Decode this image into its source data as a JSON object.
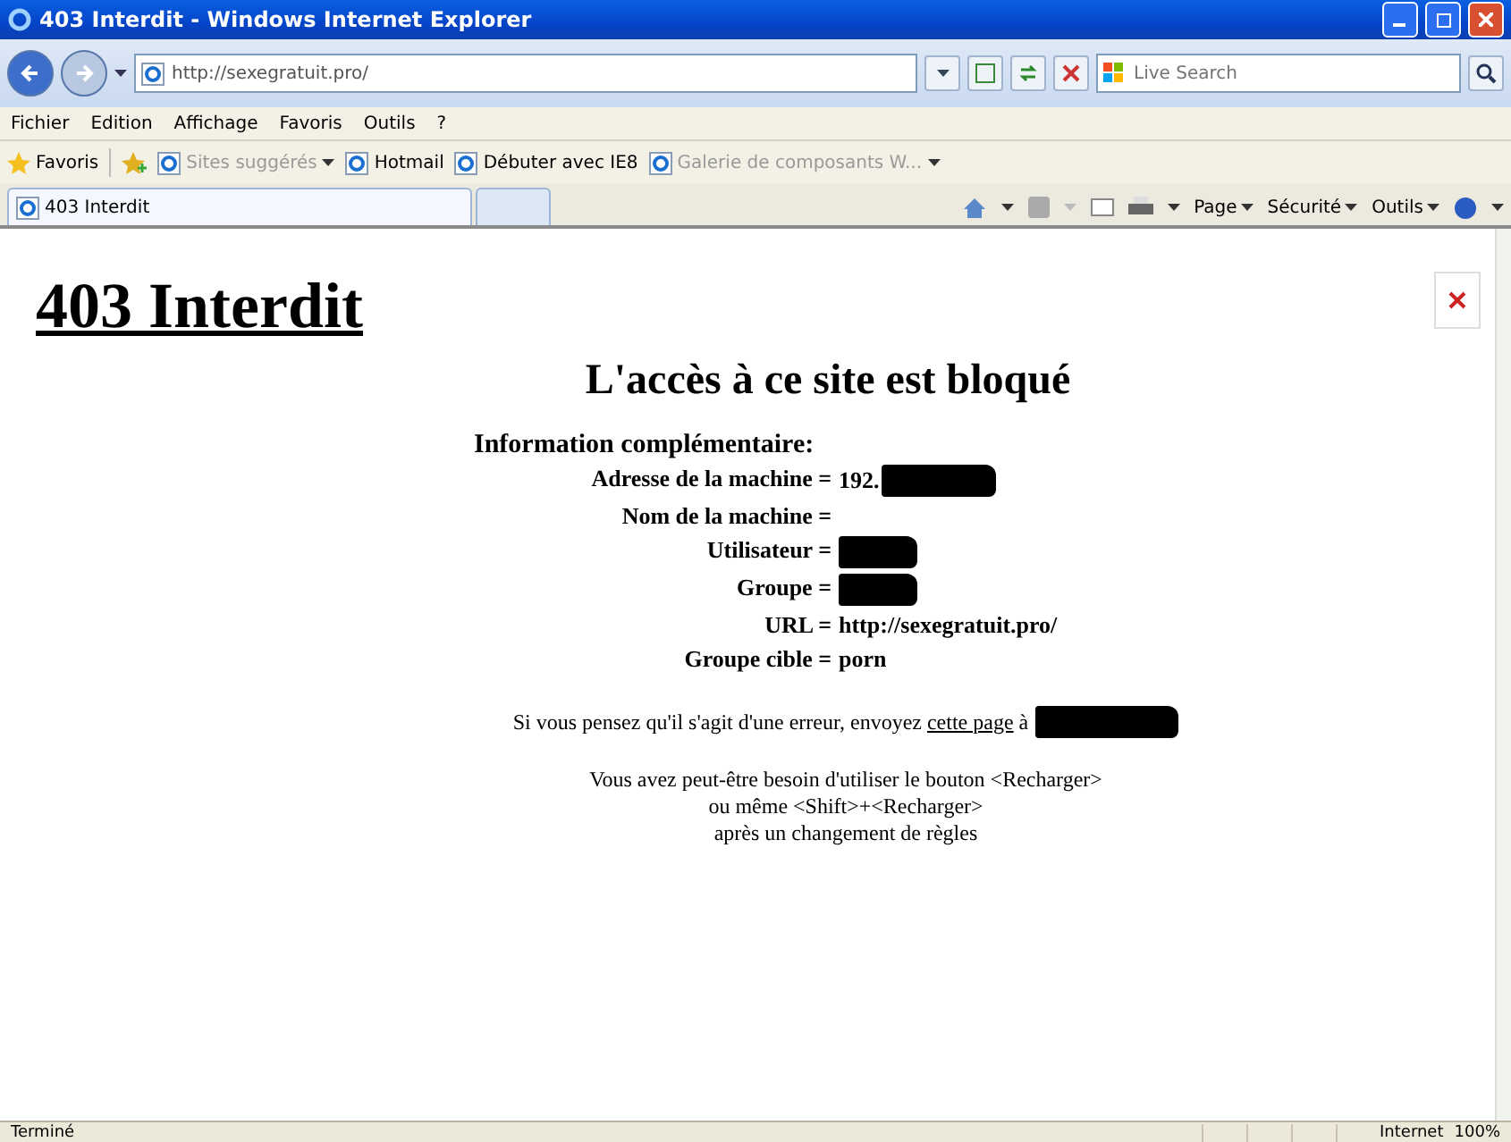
{
  "window": {
    "title": "403 Interdit - Windows Internet Explorer"
  },
  "address_bar": {
    "url": "http://sexegratuit.pro/"
  },
  "search": {
    "placeholder": "Live Search"
  },
  "menu": [
    "Fichier",
    "Edition",
    "Affichage",
    "Favoris",
    "Outils",
    "?"
  ],
  "favorites_bar": {
    "label": "Favoris",
    "links": [
      {
        "label": "Sites suggérés",
        "dimmed": true,
        "dropdown": true
      },
      {
        "label": "Hotmail",
        "dimmed": false,
        "dropdown": false
      },
      {
        "label": "Débuter avec IE8",
        "dimmed": false,
        "dropdown": false
      },
      {
        "label": "Galerie de composants W...",
        "dimmed": true,
        "dropdown": true
      }
    ]
  },
  "tabs": [
    {
      "label": "403 Interdit",
      "selected": true
    }
  ],
  "command_bar": [
    "Page",
    "Sécurité",
    "Outils"
  ],
  "page": {
    "heading": "403 Interdit",
    "subheading": "L'accès à ce site est bloqué",
    "info_title": "Information complémentaire:",
    "info_rows": [
      {
        "label": "Adresse de la machine =",
        "value": "192.",
        "redacted": true
      },
      {
        "label": "Nom de la machine =",
        "value": "",
        "redacted": false
      },
      {
        "label": "Utilisateur =",
        "value": "",
        "redacted": true
      },
      {
        "label": "Groupe =",
        "value": "",
        "redacted": true
      },
      {
        "label": "URL =",
        "value": "http://sexegratuit.pro/",
        "redacted": false
      },
      {
        "label": "Groupe cible =",
        "value": "porn",
        "redacted": false
      }
    ],
    "error_note": {
      "before": "Si vous pensez qu'il s'agit d'une erreur, envoyez",
      "link": "cette page",
      "after": "à",
      "redacted": true
    },
    "reload_lines": [
      "Vous avez peut-être besoin d'utiliser le bouton <Recharger>",
      "ou même <Shift>+<Recharger>",
      "après un changement de règles"
    ]
  },
  "status_bar": {
    "text": "Terminé",
    "zone": "Internet",
    "zoom": "100%"
  }
}
